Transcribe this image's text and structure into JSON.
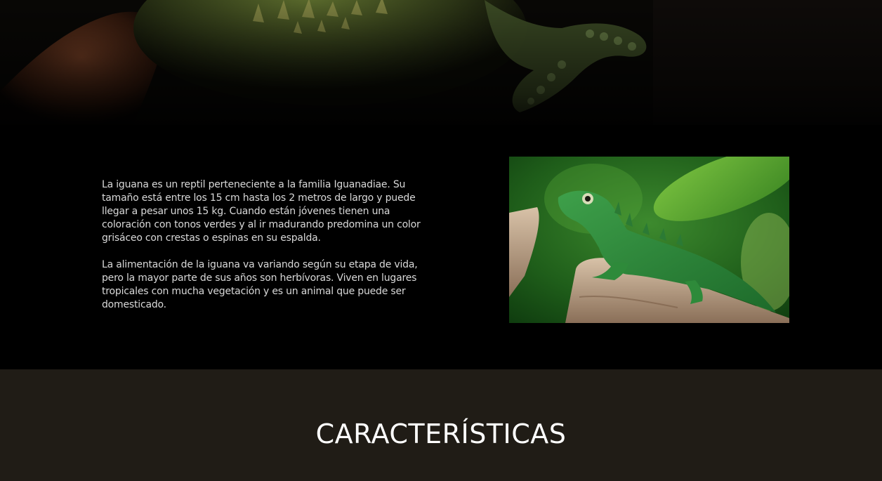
{
  "hero": {
    "image_icon": "iguana-closeup-photo"
  },
  "intro": {
    "paragraphs": [
      "La iguana es un reptil perteneciente a la familia Iguanadiae. Su tamaño está entre los 15 cm hasta los 2 metros de largo y puede llegar a pesar unos 15 kg. Cuando están jóvenes tienen una coloración con tonos verdes y al ir madurando predomina un color grisáceo con crestas o espinas en su espalda.",
      "La alimentación de la iguana va variando según su etapa de vida, pero la mayor parte de sus años son herbívoras. Viven en lugares tropicales con mucha vegetación y es un animal que puede ser domesticado."
    ],
    "image_icon": "green-iguana-photo"
  },
  "features": {
    "title": "CARACTERÍSTICAS"
  },
  "colors": {
    "page_background": "#000000",
    "features_background": "#201c16",
    "body_text": "#d9d9d9",
    "heading_text": "#ffffff"
  }
}
